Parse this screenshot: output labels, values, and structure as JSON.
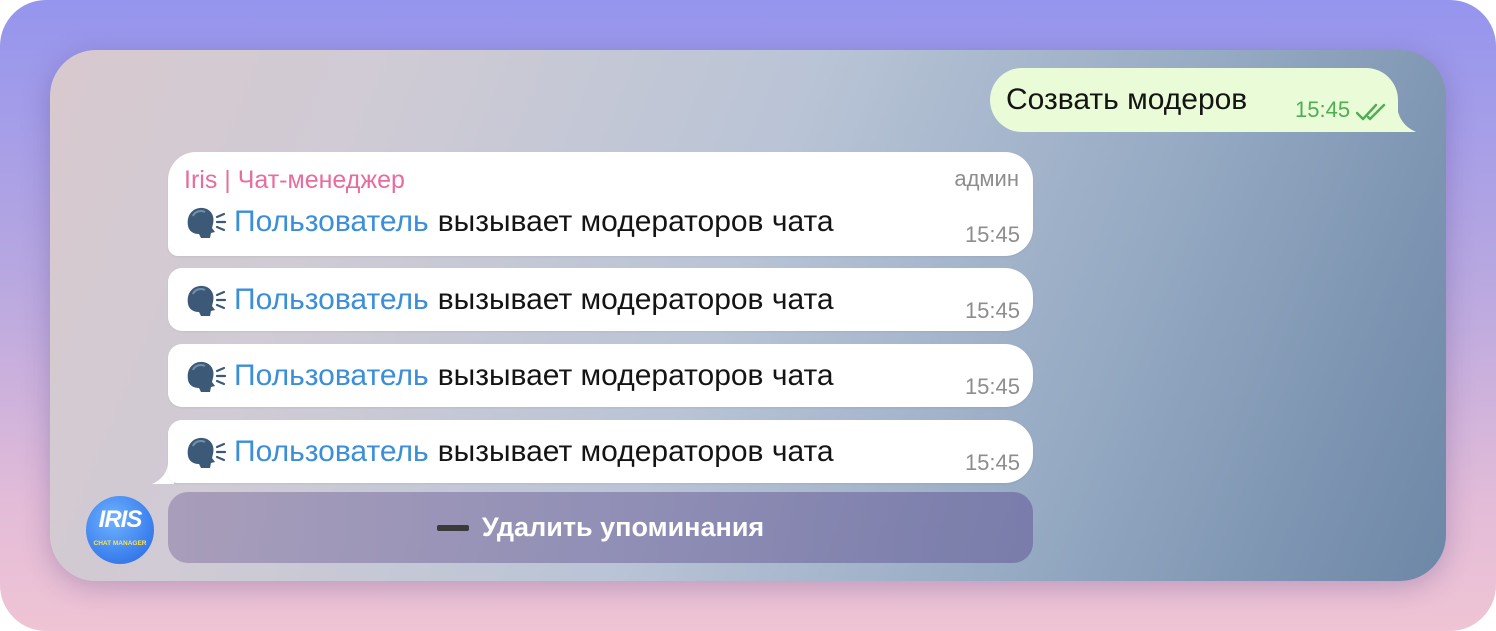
{
  "outgoing": {
    "text": "Созвать модеров",
    "time": "15:45",
    "status_icon": "double-check-icon",
    "bubble_color": "#e9fbd7",
    "time_color": "#4caf50"
  },
  "incoming": {
    "sender": "Iris | Чат-менеджер",
    "role": "админ",
    "sender_color": "#e86c9e",
    "mention_color": "#3b8ed8",
    "messages": [
      {
        "icon": "speaking-head-icon",
        "mention": "Пользователь",
        "text": "вызывает модераторов чата",
        "time": "15:45"
      },
      {
        "icon": "speaking-head-icon",
        "mention": "Пользователь",
        "text": "вызывает модераторов чата",
        "time": "15:45"
      },
      {
        "icon": "speaking-head-icon",
        "mention": "Пользователь",
        "text": "вызывает модераторов чата",
        "time": "15:45"
      },
      {
        "icon": "speaking-head-icon",
        "mention": "Пользователь",
        "text": "вызывает модераторов чата",
        "time": "15:45"
      }
    ]
  },
  "keyboard": {
    "button_icon": "minus-icon",
    "button_label": "Удалить упоминания"
  },
  "avatar": {
    "title": "IRIS",
    "subtitle": "CHAT MANAGER"
  }
}
